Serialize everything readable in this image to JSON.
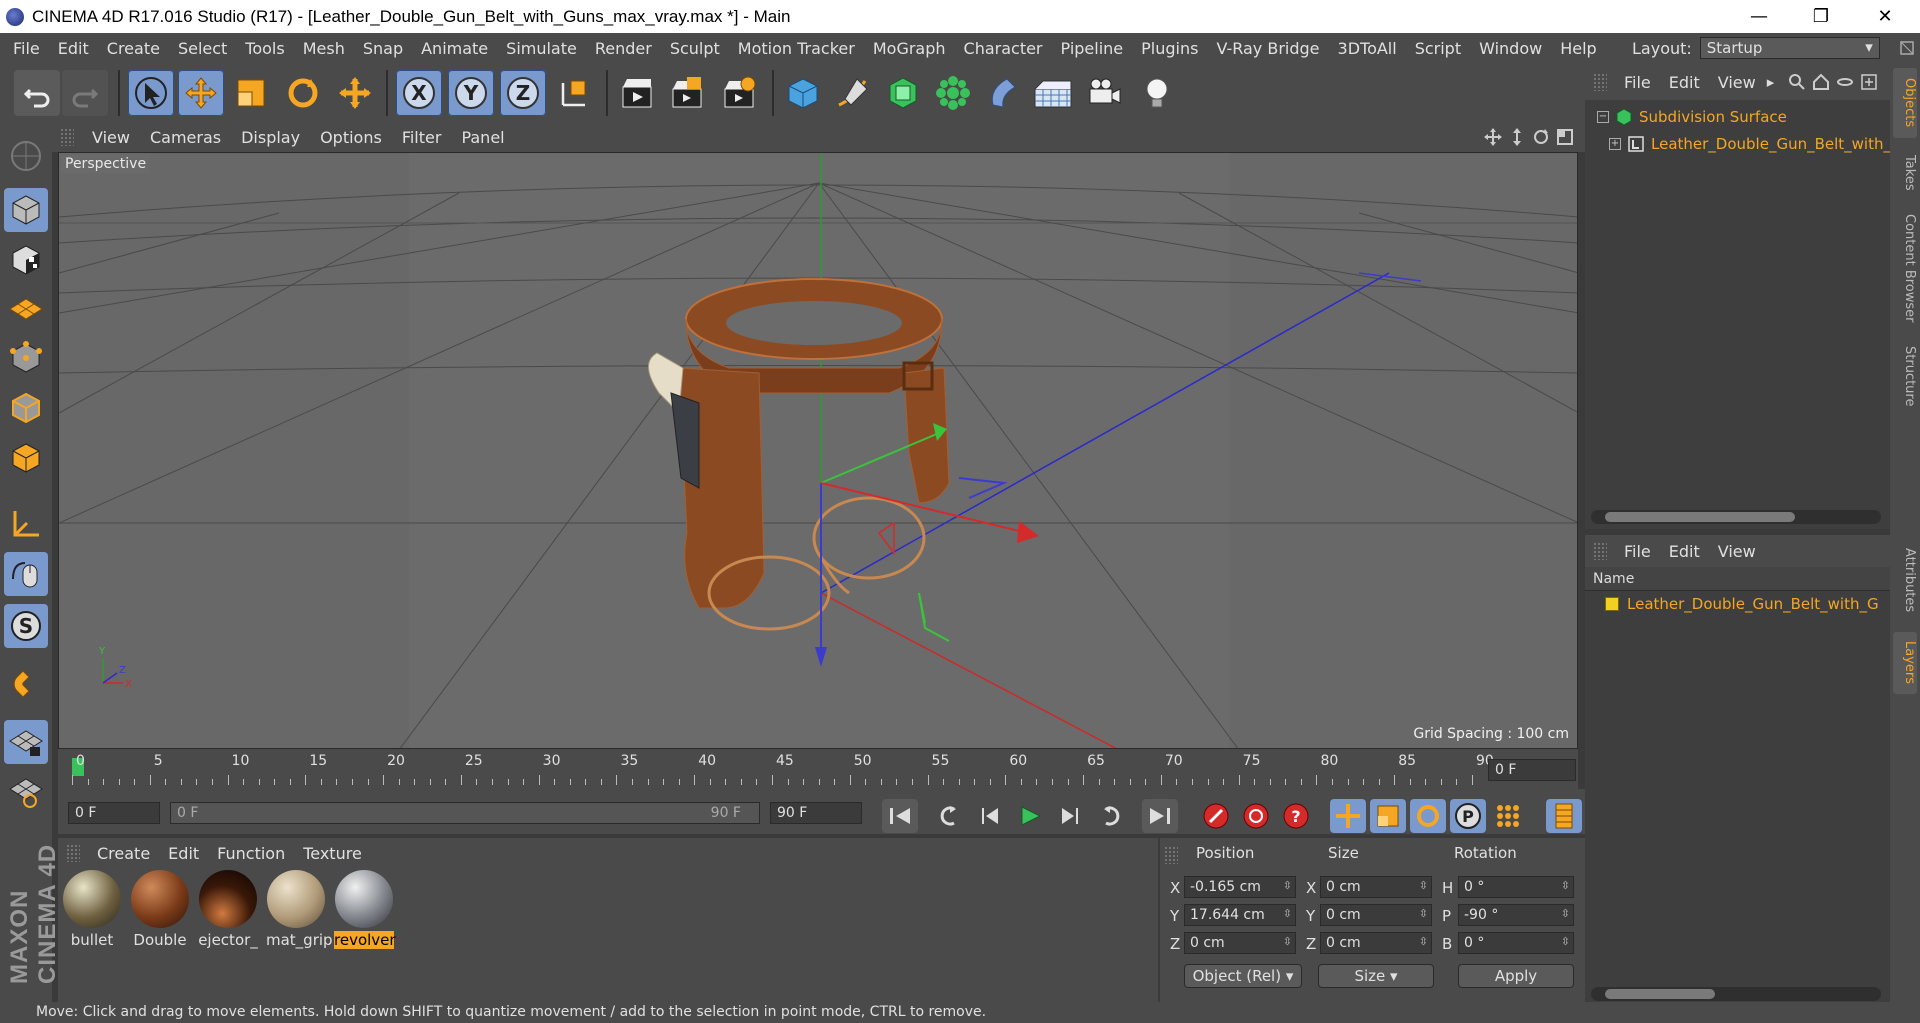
{
  "window": {
    "title": "CINEMA 4D R17.016 Studio (R17) - [Leather_Double_Gun_Belt_with_Guns_max_vray.max *] - Main",
    "minimize": "—",
    "restore": "❐",
    "close": "✕"
  },
  "menubar": {
    "items": [
      "File",
      "Edit",
      "Create",
      "Select",
      "Tools",
      "Mesh",
      "Snap",
      "Animate",
      "Simulate",
      "Render",
      "Sculpt",
      "Motion Tracker",
      "MoGraph",
      "Character",
      "Pipeline",
      "Plugins",
      "V-Ray Bridge",
      "3DToAll",
      "Script",
      "Window",
      "Help"
    ],
    "layout_label": "Layout:",
    "layout_value": "Startup"
  },
  "viewport": {
    "menu": [
      "View",
      "Cameras",
      "Display",
      "Options",
      "Filter",
      "Panel"
    ],
    "label": "Perspective",
    "grid_spacing": "Grid Spacing : 100 cm"
  },
  "timeline": {
    "ticks": [
      "0",
      "5",
      "10",
      "15",
      "20",
      "25",
      "30",
      "35",
      "40",
      "45",
      "50",
      "55",
      "60",
      "65",
      "70",
      "75",
      "80",
      "85",
      "90"
    ],
    "current_frame": "0 F"
  },
  "playbar": {
    "start": "0 F",
    "range_start": "0 F",
    "range_end": "90 F",
    "end": "90 F"
  },
  "materials": {
    "menu": [
      "Create",
      "Edit",
      "Function",
      "Texture"
    ],
    "items": [
      {
        "name": "bullet",
        "selected": false
      },
      {
        "name": "Double",
        "selected": false
      },
      {
        "name": "ejector_",
        "selected": false
      },
      {
        "name": "mat_grip",
        "selected": false
      },
      {
        "name": "revolver",
        "selected": true
      }
    ]
  },
  "coords": {
    "headers": {
      "position": "Position",
      "size": "Size",
      "rotation": "Rotation"
    },
    "pos": {
      "x": "-0.165 cm",
      "y": "17.644 cm",
      "z": "0 cm"
    },
    "size": {
      "x": "0 cm",
      "y": "0 cm",
      "z": "0 cm"
    },
    "rot": {
      "h": "0 °",
      "p": "-90 °",
      "b": "0 °"
    },
    "axis_labels": {
      "x": "X",
      "y": "Y",
      "z": "Z",
      "h": "H",
      "p": "P",
      "b": "B"
    },
    "mode": "Object (Rel)",
    "size_mode": "Size",
    "apply": "Apply"
  },
  "objects": {
    "menu": [
      "File",
      "Edit",
      "View"
    ],
    "tree": [
      {
        "name": "Subdivision Surface"
      },
      {
        "name": "Leather_Double_Gun_Belt_with_"
      }
    ]
  },
  "layers": {
    "menu": [
      "File",
      "Edit",
      "View"
    ],
    "header": "Name",
    "rows": [
      "Leather_Double_Gun_Belt_with_G"
    ]
  },
  "side_tabs": {
    "top": [
      "Objects",
      "Takes",
      "Content Browser",
      "Structure"
    ],
    "bottom": [
      "Attributes",
      "Layers"
    ]
  },
  "status": "Move: Click and drag to move elements. Hold down SHIFT to quantize movement / add to the selection in point mode, CTRL to remove.",
  "brand": "MAXON CINEMA 4D"
}
